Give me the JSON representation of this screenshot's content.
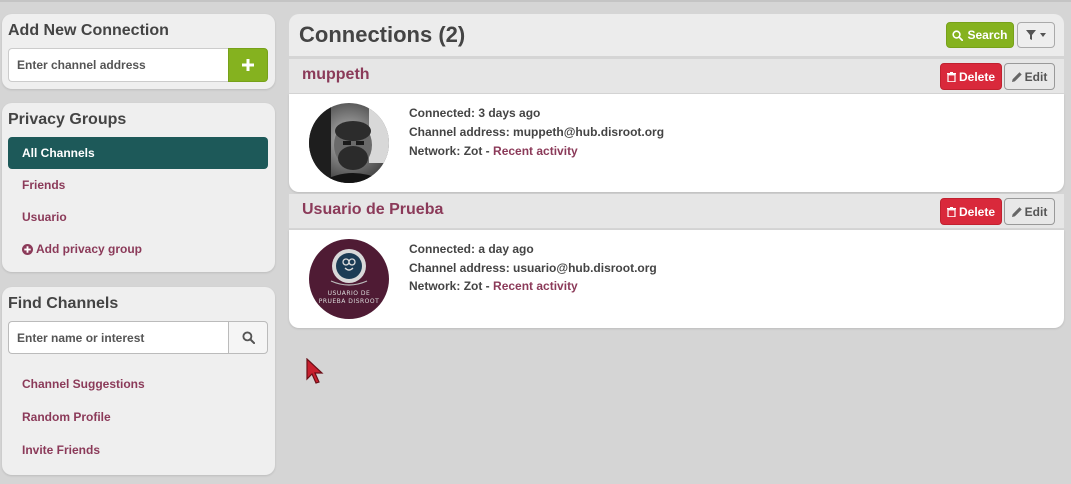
{
  "sidebar": {
    "add_connection": {
      "title": "Add New Connection",
      "input_placeholder": "Enter channel address",
      "add_icon": "plus-icon"
    },
    "privacy_groups": {
      "title": "Privacy Groups",
      "items": [
        {
          "label": "All Channels",
          "active": true
        },
        {
          "label": "Friends",
          "active": false
        },
        {
          "label": "Usuario",
          "active": false
        }
      ],
      "add_label": "Add privacy group",
      "add_icon": "plus-circle-icon"
    },
    "find_channels": {
      "title": "Find Channels",
      "input_placeholder": "Enter name or interest",
      "search_icon": "search-icon",
      "links": [
        "Channel Suggestions",
        "Random Profile",
        "Invite Friends"
      ]
    }
  },
  "main": {
    "title": "Connections (2)",
    "search_label": "Search",
    "filter_icon": "filter-icon",
    "delete_label": "Delete",
    "edit_label": "Edit",
    "connections": [
      {
        "name": "muppeth",
        "connected_label": "Connected:",
        "connected_value": "3 days ago",
        "address_label": "Channel address:",
        "address_value": "muppeth@hub.disroot.org",
        "network_label": "Network:",
        "network_value": "Zot -",
        "activity_link": "Recent activity"
      },
      {
        "name": "Usuario de Prueba",
        "connected_label": "Connected:",
        "connected_value": "a day ago",
        "address_label": "Channel address:",
        "address_value": "usuario@hub.disroot.org",
        "network_label": "Network:",
        "network_value": "Zot -",
        "activity_link": "Recent activity",
        "avatar_text": "USUARIO DE PRUEBA DISROOT"
      }
    ]
  },
  "colors": {
    "accent_green": "#85b21f",
    "active_teal": "#1d5959",
    "link": "#8b3a59",
    "danger": "#d9293b"
  }
}
